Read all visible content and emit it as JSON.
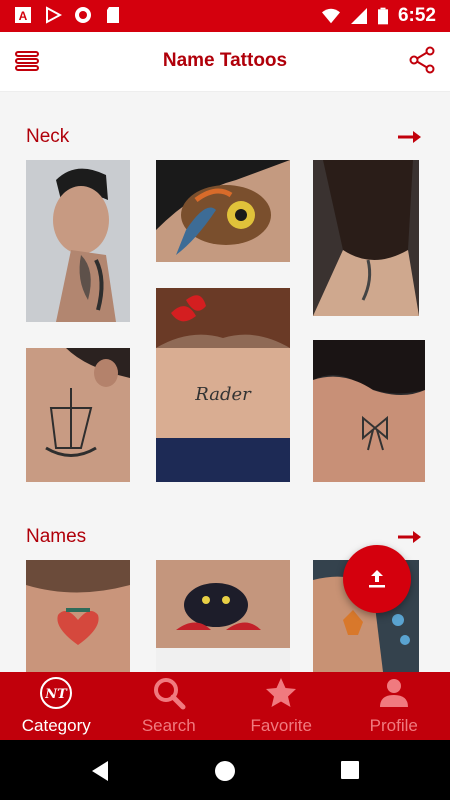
{
  "status_bar": {
    "time": "6:52",
    "icons_left": [
      "autocad-icon",
      "play-store-icon",
      "record-icon",
      "sd-card-icon"
    ],
    "icons_right": [
      "wifi-icon",
      "signal-icon",
      "battery-icon"
    ]
  },
  "header": {
    "title": "Name Tattoos",
    "menu_icon": "menu-icon",
    "share_icon": "share-icon"
  },
  "sections": [
    {
      "title": "Neck",
      "images": [
        {
          "alt": "man with neck tattoo"
        },
        {
          "alt": "owl neck tattoo"
        },
        {
          "alt": "woman back neck tattoo"
        },
        {
          "alt": "ship neck tattoo"
        },
        {
          "alt": "script neck tattoo with red bow"
        },
        {
          "alt": "bow neck tattoo"
        }
      ]
    },
    {
      "title": "Names",
      "images": [
        {
          "alt": "heart neck tattoo"
        },
        {
          "alt": "panther neck tattoo"
        },
        {
          "alt": "fox neck tattoo"
        }
      ]
    }
  ],
  "fab": {
    "icon": "upload-icon"
  },
  "bottom_nav": [
    {
      "label": "Category",
      "icon": "nt-logo-icon",
      "active": true
    },
    {
      "label": "Search",
      "icon": "search-icon",
      "active": false
    },
    {
      "label": "Favorite",
      "icon": "star-icon",
      "active": false
    },
    {
      "label": "Profile",
      "icon": "profile-icon",
      "active": false
    }
  ],
  "colors": {
    "brand": "#d4000d",
    "title": "#b0000a",
    "nav_bg": "#c1000b",
    "nav_inactive": "#f07a7f"
  }
}
